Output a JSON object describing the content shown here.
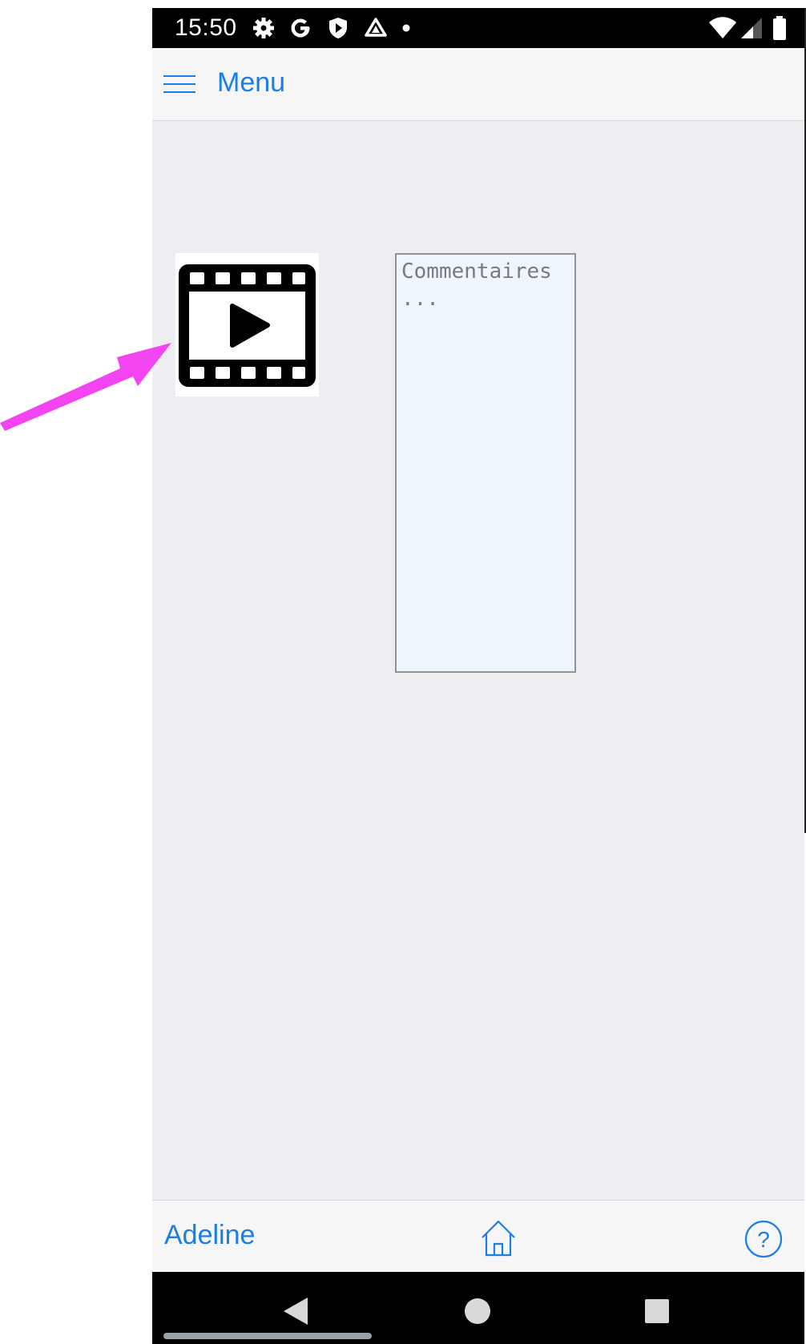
{
  "status_bar": {
    "time": "15:50",
    "left_icons": [
      "settings-gear-icon",
      "google-g-icon",
      "shield-play-icon",
      "drive-triangle-icon",
      "notification-dot-icon"
    ],
    "right_icons": [
      "wifi-icon",
      "cell-signal-icon",
      "battery-icon"
    ]
  },
  "header": {
    "menu_label": "Menu",
    "menu_icon": "hamburger-menu-icon"
  },
  "content": {
    "video_icon": "video-film-play-icon",
    "comment_placeholder": "Commentaires ...",
    "comment_value": ""
  },
  "footer": {
    "user_name": "Adeline",
    "home_icon": "home-icon",
    "help_icon": "help-circle-icon"
  },
  "nav_bar": {
    "icons": [
      "back-triangle-icon",
      "home-circle-icon",
      "recent-square-icon"
    ]
  },
  "annotation": {
    "arrow_color": "#f244f0"
  },
  "colors": {
    "accent": "#1a7ee6",
    "background": "#eeeef2",
    "bar": "#f6f6f6",
    "textarea_bg": "#eef5fd"
  }
}
